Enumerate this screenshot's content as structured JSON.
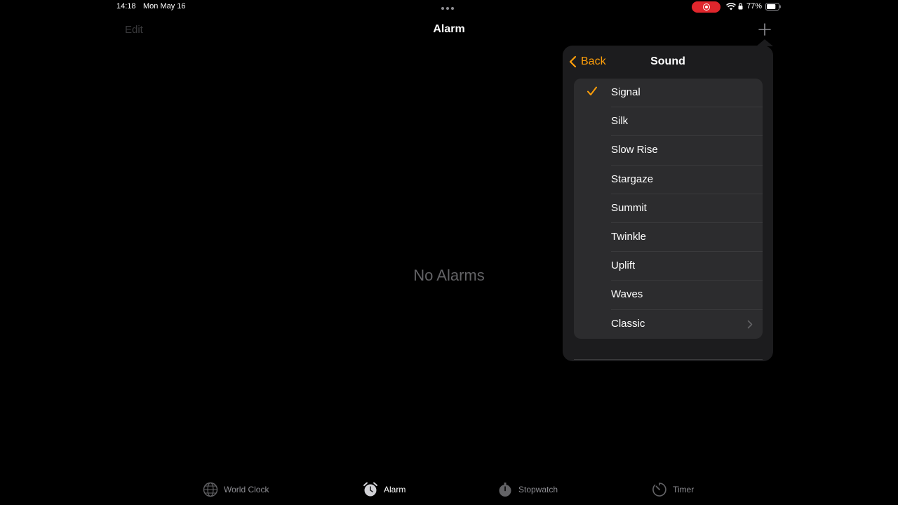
{
  "status_bar": {
    "time": "14:18",
    "date": "Mon May 16",
    "battery_pct": "77%"
  },
  "nav": {
    "edit_label": "Edit",
    "title": "Alarm"
  },
  "empty_state": "No Alarms",
  "popover": {
    "back_label": "Back",
    "title": "Sound",
    "selected": "Signal",
    "items": [
      "Signal",
      "Silk",
      "Slow Rise",
      "Stargaze",
      "Summit",
      "Twinkle",
      "Uplift",
      "Waves",
      "Classic"
    ]
  },
  "tabs": [
    {
      "label": "World Clock",
      "icon": "globe-icon"
    },
    {
      "label": "Alarm",
      "icon": "alarm-clock-icon",
      "active": true
    },
    {
      "label": "Stopwatch",
      "icon": "stopwatch-icon"
    },
    {
      "label": "Timer",
      "icon": "timer-icon"
    }
  ],
  "colors": {
    "accent": "#ff9f0a",
    "background": "#000000",
    "popover": "#1c1c1e",
    "row": "#2c2c2e",
    "record": "#e0262c"
  }
}
